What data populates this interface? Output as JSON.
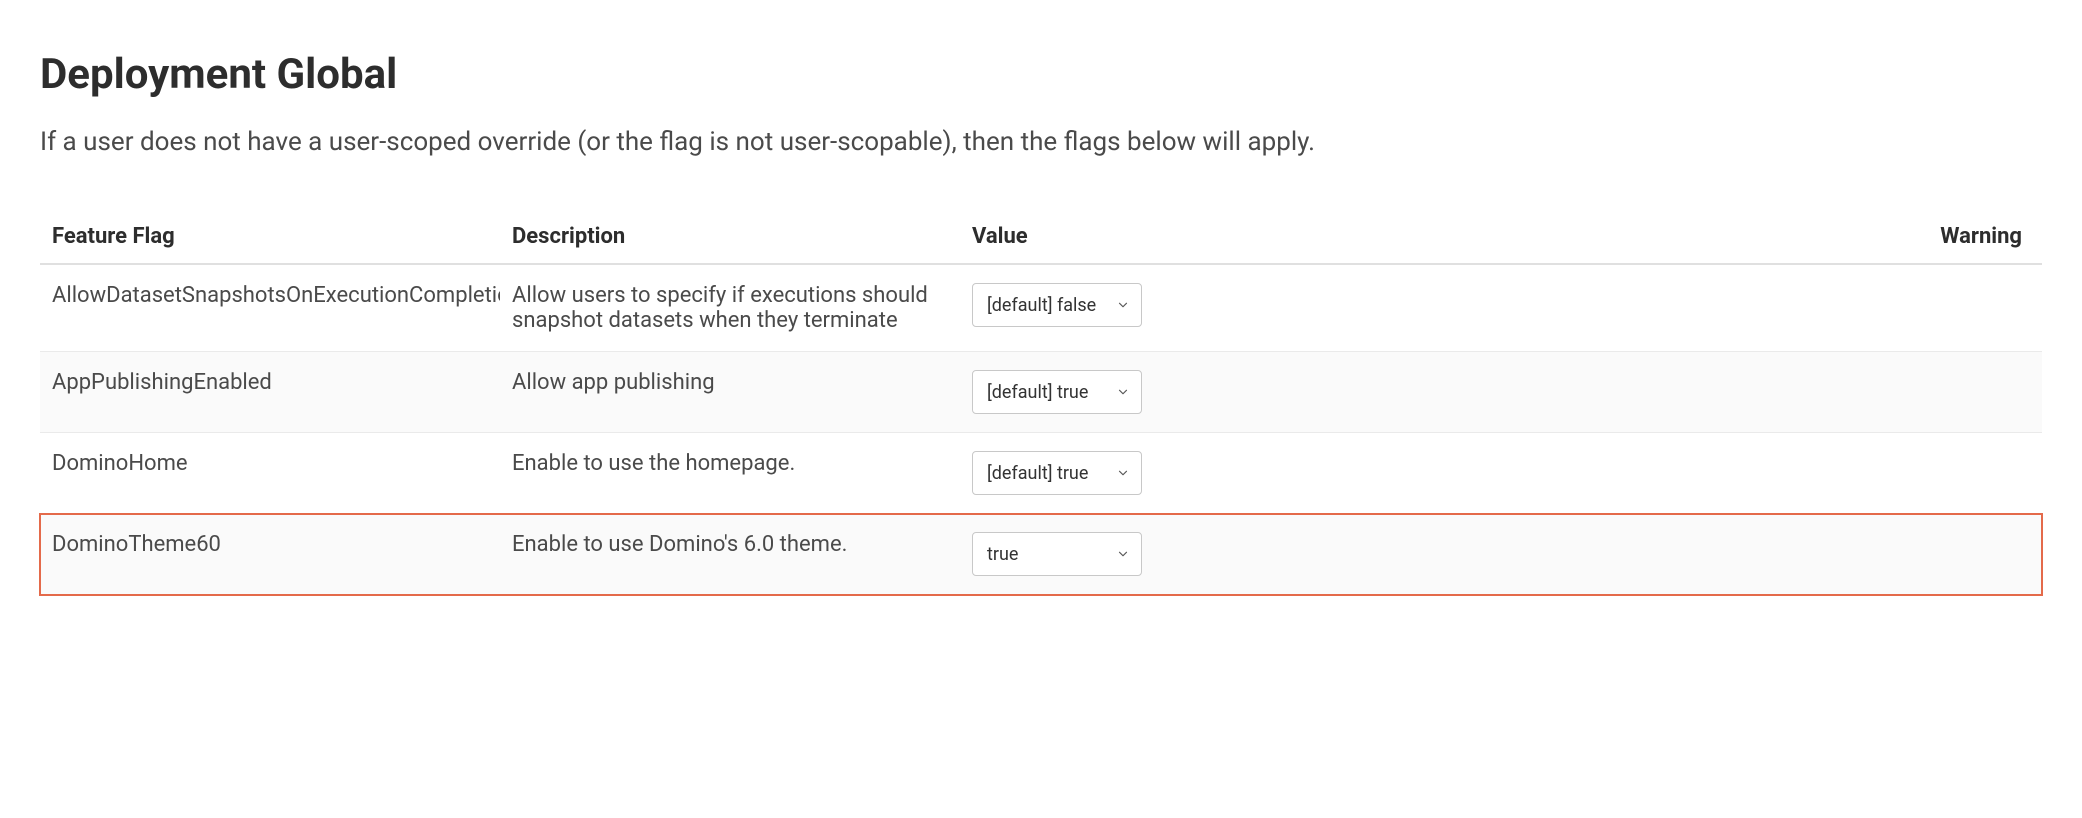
{
  "header": {
    "title": "Deployment Global",
    "description": "If a user does not have a user-scoped override (or the flag is not user-scopable), then the flags below will apply."
  },
  "table": {
    "columns": {
      "flag": "Feature Flag",
      "description": "Description",
      "value": "Value",
      "warning": "Warning"
    },
    "rows": [
      {
        "flag": "AllowDatasetSnapshotsOnExecutionCompletion",
        "description": "Allow users to specify if executions should snapshot datasets when they terminate",
        "value": "[default] false",
        "warning": "",
        "highlighted": false
      },
      {
        "flag": "AppPublishingEnabled",
        "description": "Allow app publishing",
        "value": "[default] true",
        "warning": "",
        "highlighted": false
      },
      {
        "flag": "DominoHome",
        "description": "Enable to use the homepage.",
        "value": "[default] true",
        "warning": "",
        "highlighted": false
      },
      {
        "flag": "DominoTheme60",
        "description": "Enable to use Domino's 6.0 theme.",
        "value": "true",
        "warning": "",
        "highlighted": true
      }
    ]
  }
}
